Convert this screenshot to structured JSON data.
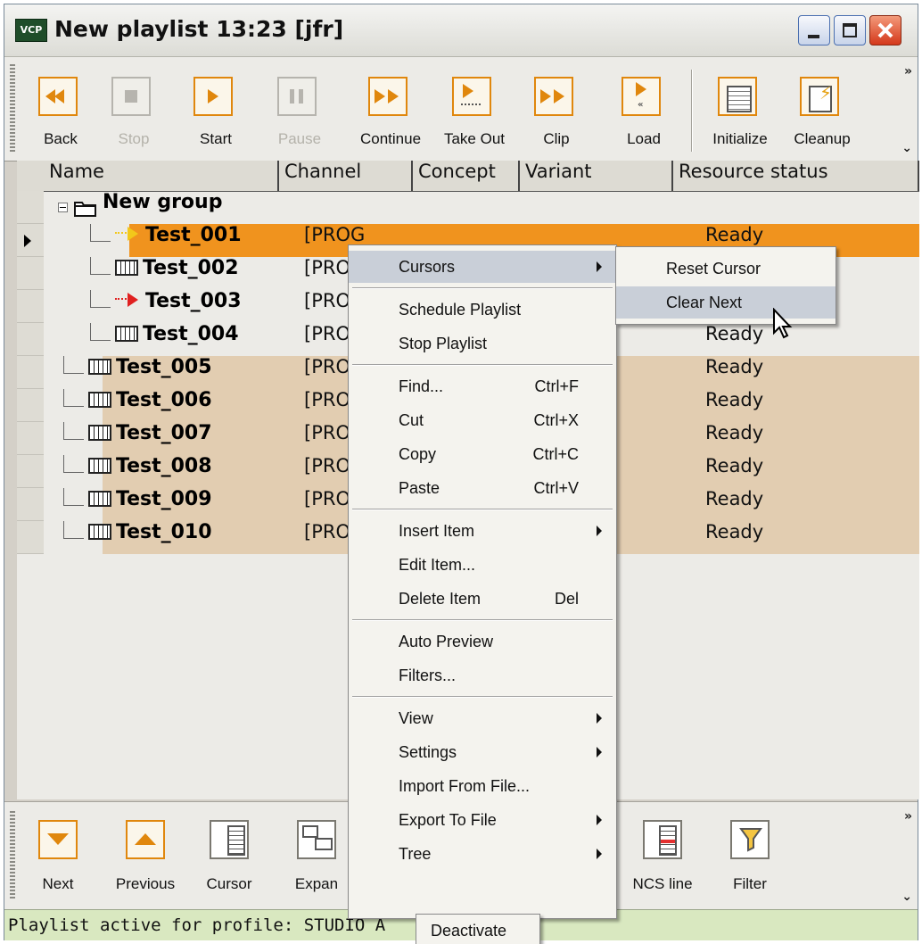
{
  "window": {
    "title": "New playlist 13:23 [jfr]",
    "app_icon_text": "VCP"
  },
  "toolbar": {
    "buttons": [
      {
        "label": "Back",
        "enabled": true,
        "icon": "rewind-icon"
      },
      {
        "label": "Stop",
        "enabled": false,
        "icon": "stop-icon"
      },
      {
        "label": "Start",
        "enabled": true,
        "icon": "play-icon"
      },
      {
        "label": "Pause",
        "enabled": false,
        "icon": "pause-icon"
      },
      {
        "label": "Continue",
        "enabled": true,
        "icon": "continue-icon"
      },
      {
        "label": "Take Out",
        "enabled": true,
        "icon": "take-out-icon"
      },
      {
        "label": "Clip",
        "enabled": true,
        "icon": "clip-icon"
      },
      {
        "label": "Load",
        "enabled": true,
        "icon": "load-icon"
      },
      {
        "label": "Initialize",
        "enabled": true,
        "icon": "initialize-icon"
      },
      {
        "label": "Cleanup",
        "enabled": true,
        "icon": "cleanup-icon"
      }
    ],
    "overflow": "»"
  },
  "grid": {
    "columns": [
      "Name",
      "Channel",
      "Concept",
      "Variant",
      "Resource status"
    ],
    "group": {
      "label": "New group"
    },
    "rows": [
      {
        "name": "Test_001",
        "channel": "[PROG",
        "status": "Ready",
        "icon": "yellow-arrow-icon",
        "in_group": true,
        "current": true
      },
      {
        "name": "Test_002",
        "channel": "[PROG",
        "status": "",
        "icon": "item-icon",
        "in_group": true
      },
      {
        "name": "Test_003",
        "channel": "[PROG",
        "status": "",
        "icon": "red-arrow-icon",
        "in_group": true
      },
      {
        "name": "Test_004",
        "channel": "[PROG",
        "status": "Ready",
        "icon": "item-icon",
        "in_group": true
      },
      {
        "name": "Test_005",
        "channel": "[PROG",
        "status": "Ready",
        "icon": "item-icon",
        "in_group": false
      },
      {
        "name": "Test_006",
        "channel": "[PROG",
        "status": "Ready",
        "icon": "item-icon",
        "in_group": false
      },
      {
        "name": "Test_007",
        "channel": "[PROG",
        "status": "Ready",
        "icon": "item-icon",
        "in_group": false
      },
      {
        "name": "Test_008",
        "channel": "[PROG",
        "status": "Ready",
        "icon": "item-icon",
        "in_group": false
      },
      {
        "name": "Test_009",
        "channel": "[PROG",
        "status": "Ready",
        "icon": "item-icon",
        "in_group": false
      },
      {
        "name": "Test_010",
        "channel": "[PROG",
        "status": "Ready",
        "icon": "item-icon",
        "in_group": false
      }
    ],
    "row_colors": {
      "current": "#f0931e",
      "group": "#ecebe7",
      "top": "#e2cdb1"
    }
  },
  "bottom_toolbar": {
    "buttons": [
      {
        "label": "Next",
        "icon": "down-triangle-icon"
      },
      {
        "label": "Previous",
        "icon": "up-triangle-icon"
      },
      {
        "label": "Cursor",
        "icon": "cursor-icon"
      },
      {
        "label": "Expan",
        "icon": "expand-icon"
      },
      {
        "label": "NCS line",
        "icon": "ncs-line-icon"
      },
      {
        "label": "Filter",
        "icon": "filter-icon"
      }
    ],
    "overflow": "»"
  },
  "status_bar": {
    "text": "Playlist active for profile: STUDIO A"
  },
  "context_menu": {
    "items": [
      {
        "label": "Cursors",
        "shortcut": "",
        "submenu": true,
        "highlighted": true
      },
      {
        "label": "Schedule Playlist",
        "shortcut": "",
        "submenu": false
      },
      {
        "label": "Stop Playlist",
        "shortcut": "",
        "submenu": false
      },
      {
        "label": "Find...",
        "shortcut": "Ctrl+F",
        "submenu": false
      },
      {
        "label": "Cut",
        "shortcut": "Ctrl+X",
        "submenu": false
      },
      {
        "label": "Copy",
        "shortcut": "Ctrl+C",
        "submenu": false
      },
      {
        "label": "Paste",
        "shortcut": "Ctrl+V",
        "submenu": false
      },
      {
        "label": "Insert Item",
        "shortcut": "",
        "submenu": true
      },
      {
        "label": "Edit Item...",
        "shortcut": "",
        "submenu": false
      },
      {
        "label": "Delete Item",
        "shortcut": "Del",
        "submenu": false
      },
      {
        "label": "Auto Preview",
        "shortcut": "",
        "submenu": false
      },
      {
        "label": "Filters...",
        "shortcut": "",
        "submenu": false
      },
      {
        "label": "View",
        "shortcut": "",
        "submenu": true
      },
      {
        "label": "Settings",
        "shortcut": "",
        "submenu": true
      },
      {
        "label": "Import From File...",
        "shortcut": "",
        "submenu": false
      },
      {
        "label": "Export To File",
        "shortcut": "",
        "submenu": true
      },
      {
        "label": "Tree",
        "shortcut": "",
        "submenu": true
      }
    ]
  },
  "cursors_submenu": {
    "items": [
      {
        "label": "Reset Cursor",
        "highlighted": false
      },
      {
        "label": "Clear Next",
        "highlighted": true
      }
    ]
  },
  "deactivate_popup": {
    "label": "Deactivate"
  }
}
